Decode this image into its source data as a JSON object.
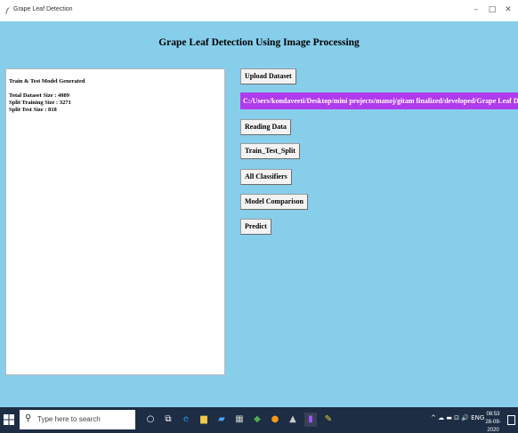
{
  "window": {
    "title": "Grape Leaf Detection",
    "minimize_glyph": "–",
    "maximize_glyph": "□",
    "close_glyph": "✕"
  },
  "app": {
    "heading": "Grape Leaf Detection Using Image Processing",
    "path_display": "C:/Users/kondaveeti/Desktop/mini projects/manoj/gitam finalized/developed/Grape Leaf Disease Ide",
    "path_bg_color": "#b03bec"
  },
  "log": {
    "line1": "Train & Test Model Generated",
    "line2": "Total Dataset Size : 4089",
    "line3": "Split Training Size : 3271",
    "line4": "Split Test Size : 818"
  },
  "buttons": {
    "upload": "Upload Dataset",
    "reading": "Reading Data",
    "split": "Train_Test_Split",
    "classifiers": "All Classifiers",
    "comparison": "Model Comparison",
    "predict": "Predict"
  },
  "taskbar": {
    "search_placeholder": "Type here to search",
    "tray_text": "^ ☁ ▬ ⊡ 🔊 ENG",
    "time": "08:53",
    "date": "28-09-2020"
  }
}
